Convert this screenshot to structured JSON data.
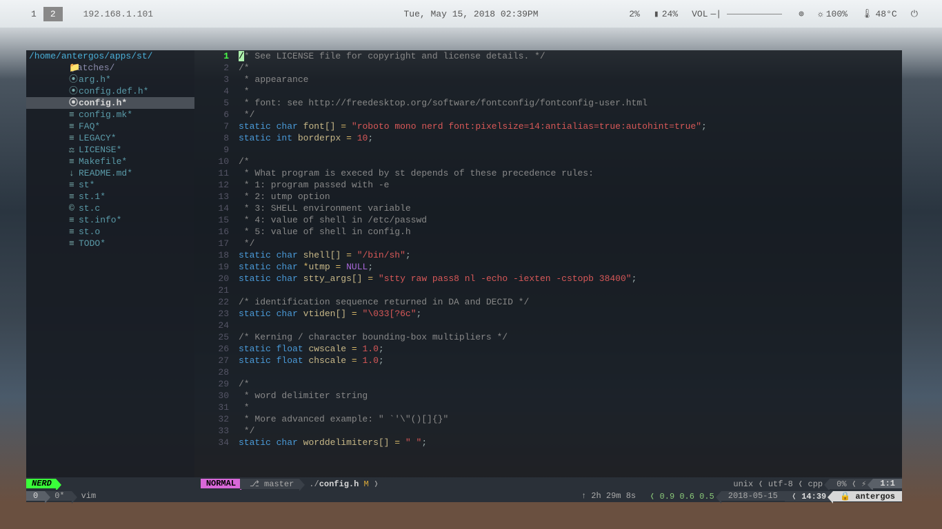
{
  "topbar": {
    "workspaces": [
      "1",
      "2"
    ],
    "active_ws": "2",
    "ip": "192.168.1.101",
    "datetime": "Tue, May 15, 2018 02:39PM",
    "cpu": "2%",
    "battery": "24%",
    "vol_label": "VOL",
    "wifi": "100%",
    "temp": "48°C"
  },
  "path": {
    "p1": "/home/",
    "p2": "antergos/",
    "p3": "apps/",
    "p4": "st/"
  },
  "files": [
    {
      "icon": "📁",
      "name": "patches/",
      "folder": true
    },
    {
      "icon": "⦿",
      "name": "arg.h*"
    },
    {
      "icon": "⦿",
      "name": "config.def.h*"
    },
    {
      "icon": "⦿",
      "name": "config.h*",
      "selected": true
    },
    {
      "icon": "≡",
      "name": "config.mk*"
    },
    {
      "icon": "≡",
      "name": "FAQ*"
    },
    {
      "icon": "≡",
      "name": "LEGACY*"
    },
    {
      "icon": "⚖",
      "name": "LICENSE*"
    },
    {
      "icon": "≡",
      "name": "Makefile*"
    },
    {
      "icon": "↓",
      "name": "README.md*"
    },
    {
      "icon": "≡",
      "name": "st*"
    },
    {
      "icon": "≡",
      "name": "st.1*"
    },
    {
      "icon": "©",
      "name": "st.c"
    },
    {
      "icon": "≡",
      "name": "st.info*"
    },
    {
      "icon": "≡",
      "name": "st.o"
    },
    {
      "icon": "≡",
      "name": "TODO*"
    }
  ],
  "code": {
    "lines": [
      {
        "n": 1,
        "tokens": [
          {
            "t": "cursor",
            "v": "/"
          },
          {
            "t": "comment",
            "v": "* See LICENSE file for copyright and license details. */"
          }
        ]
      },
      {
        "n": 2,
        "tokens": [
          {
            "t": "comment",
            "v": "/*"
          }
        ]
      },
      {
        "n": 3,
        "tokens": [
          {
            "t": "comment",
            "v": " * appearance"
          }
        ]
      },
      {
        "n": 4,
        "tokens": [
          {
            "t": "comment",
            "v": " *"
          }
        ]
      },
      {
        "n": 5,
        "tokens": [
          {
            "t": "comment",
            "v": " * font: see http://freedesktop.org/software/fontconfig/fontconfig-user.html"
          }
        ]
      },
      {
        "n": 6,
        "tokens": [
          {
            "t": "comment",
            "v": " */"
          }
        ]
      },
      {
        "n": 7,
        "tokens": [
          {
            "t": "kw",
            "v": "static"
          },
          {
            "t": "p",
            "v": " "
          },
          {
            "t": "type",
            "v": "char"
          },
          {
            "t": "p",
            "v": " "
          },
          {
            "t": "ident",
            "v": "font[]"
          },
          {
            "t": "p",
            "v": " "
          },
          {
            "t": "op",
            "v": "="
          },
          {
            "t": "p",
            "v": " "
          },
          {
            "t": "str",
            "v": "\"roboto mono nerd font:pixelsize=14:antialias=true:autohint=true\""
          },
          {
            "t": "p",
            "v": ";"
          }
        ]
      },
      {
        "n": 8,
        "tokens": [
          {
            "t": "kw",
            "v": "static"
          },
          {
            "t": "p",
            "v": " "
          },
          {
            "t": "type",
            "v": "int"
          },
          {
            "t": "p",
            "v": " "
          },
          {
            "t": "ident",
            "v": "borderpx"
          },
          {
            "t": "p",
            "v": " "
          },
          {
            "t": "op",
            "v": "="
          },
          {
            "t": "p",
            "v": " "
          },
          {
            "t": "num",
            "v": "10"
          },
          {
            "t": "p",
            "v": ";"
          }
        ]
      },
      {
        "n": 9,
        "tokens": []
      },
      {
        "n": 10,
        "tokens": [
          {
            "t": "comment",
            "v": "/*"
          }
        ]
      },
      {
        "n": 11,
        "tokens": [
          {
            "t": "comment",
            "v": " * What program is execed by st depends of these precedence rules:"
          }
        ]
      },
      {
        "n": 12,
        "tokens": [
          {
            "t": "comment",
            "v": " * 1: program passed with -e"
          }
        ]
      },
      {
        "n": 13,
        "tokens": [
          {
            "t": "comment",
            "v": " * 2: utmp option"
          }
        ]
      },
      {
        "n": 14,
        "tokens": [
          {
            "t": "comment",
            "v": " * 3: SHELL environment variable"
          }
        ]
      },
      {
        "n": 15,
        "tokens": [
          {
            "t": "comment",
            "v": " * 4: value of shell in /etc/passwd"
          }
        ]
      },
      {
        "n": 16,
        "tokens": [
          {
            "t": "comment",
            "v": " * 5: value of shell in config.h"
          }
        ]
      },
      {
        "n": 17,
        "tokens": [
          {
            "t": "comment",
            "v": " */"
          }
        ]
      },
      {
        "n": 18,
        "tokens": [
          {
            "t": "kw",
            "v": "static"
          },
          {
            "t": "p",
            "v": " "
          },
          {
            "t": "type",
            "v": "char"
          },
          {
            "t": "p",
            "v": " "
          },
          {
            "t": "ident",
            "v": "shell[]"
          },
          {
            "t": "p",
            "v": " "
          },
          {
            "t": "op",
            "v": "="
          },
          {
            "t": "p",
            "v": " "
          },
          {
            "t": "str",
            "v": "\"/bin/sh\""
          },
          {
            "t": "p",
            "v": ";"
          }
        ]
      },
      {
        "n": 19,
        "tokens": [
          {
            "t": "kw",
            "v": "static"
          },
          {
            "t": "p",
            "v": " "
          },
          {
            "t": "type",
            "v": "char"
          },
          {
            "t": "p",
            "v": " "
          },
          {
            "t": "op",
            "v": "*"
          },
          {
            "t": "ident",
            "v": "utmp"
          },
          {
            "t": "p",
            "v": " "
          },
          {
            "t": "op",
            "v": "="
          },
          {
            "t": "p",
            "v": " "
          },
          {
            "t": "null",
            "v": "NULL"
          },
          {
            "t": "p",
            "v": ";"
          }
        ]
      },
      {
        "n": 20,
        "tokens": [
          {
            "t": "kw",
            "v": "static"
          },
          {
            "t": "p",
            "v": " "
          },
          {
            "t": "type",
            "v": "char"
          },
          {
            "t": "p",
            "v": " "
          },
          {
            "t": "ident",
            "v": "stty_args[]"
          },
          {
            "t": "p",
            "v": " "
          },
          {
            "t": "op",
            "v": "="
          },
          {
            "t": "p",
            "v": " "
          },
          {
            "t": "str",
            "v": "\"stty raw pass8 nl -echo -iexten -cstopb 38400\""
          },
          {
            "t": "p",
            "v": ";"
          }
        ]
      },
      {
        "n": 21,
        "tokens": []
      },
      {
        "n": 22,
        "tokens": [
          {
            "t": "comment",
            "v": "/* identification sequence returned in DA and DECID */"
          }
        ]
      },
      {
        "n": 23,
        "tokens": [
          {
            "t": "kw",
            "v": "static"
          },
          {
            "t": "p",
            "v": " "
          },
          {
            "t": "type",
            "v": "char"
          },
          {
            "t": "p",
            "v": " "
          },
          {
            "t": "ident",
            "v": "vtiden[]"
          },
          {
            "t": "p",
            "v": " "
          },
          {
            "t": "op",
            "v": "="
          },
          {
            "t": "p",
            "v": " "
          },
          {
            "t": "str",
            "v": "\"\\033[?6c\""
          },
          {
            "t": "p",
            "v": ";"
          }
        ]
      },
      {
        "n": 24,
        "tokens": []
      },
      {
        "n": 25,
        "tokens": [
          {
            "t": "comment",
            "v": "/* Kerning / character bounding-box multipliers */"
          }
        ]
      },
      {
        "n": 26,
        "tokens": [
          {
            "t": "kw",
            "v": "static"
          },
          {
            "t": "p",
            "v": " "
          },
          {
            "t": "type",
            "v": "float"
          },
          {
            "t": "p",
            "v": " "
          },
          {
            "t": "ident",
            "v": "cwscale"
          },
          {
            "t": "p",
            "v": " "
          },
          {
            "t": "op",
            "v": "="
          },
          {
            "t": "p",
            "v": " "
          },
          {
            "t": "num",
            "v": "1.0"
          },
          {
            "t": "p",
            "v": ";"
          }
        ]
      },
      {
        "n": 27,
        "tokens": [
          {
            "t": "kw",
            "v": "static"
          },
          {
            "t": "p",
            "v": " "
          },
          {
            "t": "type",
            "v": "float"
          },
          {
            "t": "p",
            "v": " "
          },
          {
            "t": "ident",
            "v": "chscale"
          },
          {
            "t": "p",
            "v": " "
          },
          {
            "t": "op",
            "v": "="
          },
          {
            "t": "p",
            "v": " "
          },
          {
            "t": "num",
            "v": "1.0"
          },
          {
            "t": "p",
            "v": ";"
          }
        ]
      },
      {
        "n": 28,
        "tokens": []
      },
      {
        "n": 29,
        "tokens": [
          {
            "t": "comment",
            "v": "/*"
          }
        ]
      },
      {
        "n": 30,
        "tokens": [
          {
            "t": "comment",
            "v": " * word delimiter string"
          }
        ]
      },
      {
        "n": 31,
        "tokens": [
          {
            "t": "comment",
            "v": " *"
          }
        ]
      },
      {
        "n": 32,
        "tokens": [
          {
            "t": "comment",
            "v": " * More advanced example: \" `'\\\"()[]{}\""
          }
        ]
      },
      {
        "n": 33,
        "tokens": [
          {
            "t": "comment",
            "v": " */"
          }
        ]
      },
      {
        "n": 34,
        "tokens": [
          {
            "t": "kw",
            "v": "static"
          },
          {
            "t": "p",
            "v": " "
          },
          {
            "t": "type",
            "v": "char"
          },
          {
            "t": "p",
            "v": " "
          },
          {
            "t": "ident",
            "v": "worddelimiters[]"
          },
          {
            "t": "p",
            "v": " "
          },
          {
            "t": "op",
            "v": "="
          },
          {
            "t": "p",
            "v": " "
          },
          {
            "t": "str",
            "v": "\" \""
          },
          {
            "t": "p",
            "v": ";"
          }
        ]
      }
    ]
  },
  "statusline": {
    "nerd": "NERD",
    "mode": "NORMAL",
    "branch": "⎇ master",
    "path_prefix": "./",
    "filename": "config.h",
    "modified": "M",
    "fileformat": "unix",
    "encoding": "utf-8",
    "filetype": "cpp",
    "percent": "0%",
    "position": "1:1"
  },
  "tmux": {
    "session": "0",
    "window": "0*",
    "pane": "vim",
    "uptime": "↑  2h 29m 8s",
    "load": "0.9 0.6 0.5",
    "date": "2018-05-15",
    "time": "14:39",
    "host": "🔒 antergos"
  }
}
